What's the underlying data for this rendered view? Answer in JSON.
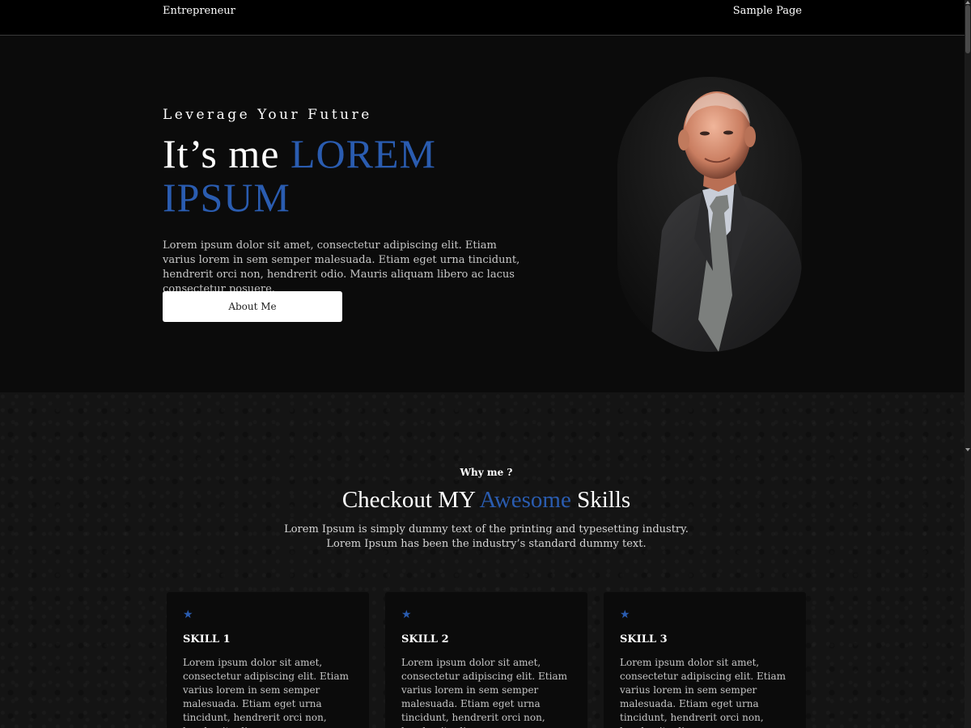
{
  "header": {
    "brand": "Entrepreneur",
    "nav": [
      "Sample Page"
    ]
  },
  "hero": {
    "kicker": "Leverage Your Future",
    "title_prefix": "It’s me ",
    "title_highlight": "LOREM IPSUM",
    "description": "Lorem ipsum dolor sit amet, consectetur adipiscing elit. Etiam varius lorem in sem semper malesuada. Etiam eget urna tincidunt, hendrerit orci non, hendrerit odio. Mauris aliquam libero ac lacus consectetur posuere.",
    "button_label": "About Me"
  },
  "skills": {
    "eyebrow": "Why me ?",
    "title_prefix": "Checkout MY ",
    "title_highlight": "Awesome",
    "title_suffix": " Skills",
    "subtitle_line1": "Lorem Ipsum is simply dummy text of the printing and typesetting industry.",
    "subtitle_line2": "Lorem Ipsum has been the industry’s standard dummy text.",
    "cards": [
      {
        "icon": "star-icon",
        "title": "SKILL 1",
        "text": "Lorem ipsum dolor sit amet, consectetur adipiscing elit. Etiam varius lorem in sem semper malesuada. Etiam eget urna tincidunt, hendrerit orci non, hendrerit odio."
      },
      {
        "icon": "star-icon",
        "title": "SKILL 2",
        "text": "Lorem ipsum dolor sit amet, consectetur adipiscing elit. Etiam varius lorem in sem semper malesuada. Etiam eget urna tincidunt, hendrerit orci non, hendrerit odio."
      },
      {
        "icon": "star-icon",
        "title": "SKILL 3",
        "text": "Lorem ipsum dolor sit amet, consectetur adipiscing elit. Etiam varius lorem in sem semper malesuada. Etiam eget urna tincidunt, hendrerit orci non, hendrerit odio."
      }
    ]
  },
  "colors": {
    "accent": "#2a5cb0",
    "background": "#0b0b0b",
    "section_background": "#141414"
  }
}
